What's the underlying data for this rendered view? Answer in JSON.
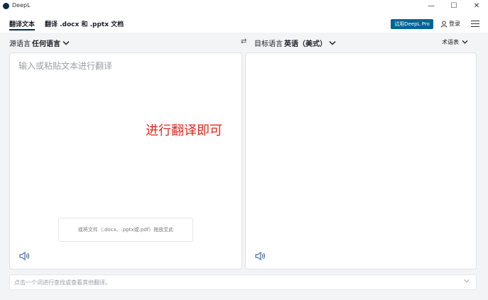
{
  "window": {
    "title": "DeepL",
    "minimize_glyph": "—",
    "maximize_glyph": "☐",
    "close_glyph": "✕"
  },
  "tabs": [
    {
      "label": "翻译文本",
      "active": true
    },
    {
      "label": "翻译 .docx 和 .pptx 文档",
      "active": false
    }
  ],
  "header": {
    "pro_button": "试用DeepL Pro",
    "login_label": "登录"
  },
  "languages": {
    "source_prefix": "源语言",
    "source_value": "任何语言",
    "swap_glyph": "⇄",
    "target_prefix": "目标语言",
    "target_value": "英语（美式）",
    "glossary_label": "术语表"
  },
  "source_panel": {
    "placeholder": "输入或粘贴文本进行翻译",
    "dropzone_text": "或将文件（.docx、.pptx或.pdf）拖放至此"
  },
  "overlay_annotation": "进行翻译即可",
  "bottom_bar": {
    "hint": "点击一个词进行查找或查看其他翻译。"
  },
  "colors": {
    "pro_button_bg": "#006494",
    "overlay_text": "#e2281e",
    "accent": "#0f2b46"
  }
}
